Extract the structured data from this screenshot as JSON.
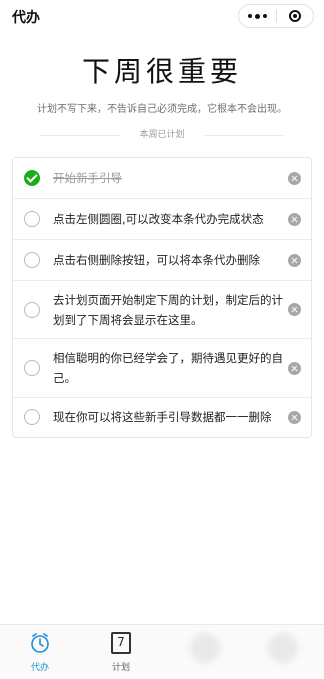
{
  "nav": {
    "title": "代办",
    "more_icon": "more-dots-icon",
    "close_icon": "target-circle-icon"
  },
  "header": {
    "title": "下周很重要",
    "subtitle": "计划不写下来，不告诉自己必须完成，它根本不会出现。",
    "section_label": "本周已计划"
  },
  "tasks": [
    {
      "text": "开始新手引导",
      "done": true
    },
    {
      "text": "点击左侧圆圈,可以改变本条代办完成状态",
      "done": false
    },
    {
      "text": "点击右侧删除按钮，可以将本条代办删除",
      "done": false
    },
    {
      "text": "去计划页面开始制定下周的计划，制定后的计划到了下周将会显示在这里。",
      "done": false
    },
    {
      "text": "相信聪明的你已经学会了，期待遇见更好的自己。",
      "done": false
    },
    {
      "text": "现在你可以将这些新手引导数据都一一删除",
      "done": false
    }
  ],
  "tabbar": {
    "todo_label": "代办",
    "plan_label": "计划",
    "plan_icon_number": "7",
    "todo_icon": "clock-icon",
    "plan_icon": "calendar-icon",
    "active_color": "#1a8fd6"
  },
  "colors": {
    "done_check": "#1aad19",
    "delete_icon": "#a8a8a8"
  }
}
